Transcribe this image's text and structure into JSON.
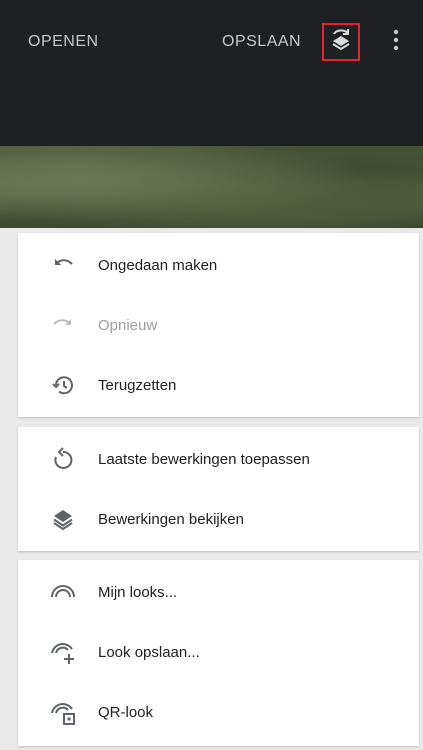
{
  "app_bar": {
    "open_label": "OPENEN",
    "save_label": "OPSLAAN",
    "stack_icon": "layers-undo-icon",
    "more_icon": "more-vert-icon"
  },
  "menu": {
    "groups": [
      {
        "items": [
          {
            "label": "Ongedaan maken",
            "icon": "undo-icon",
            "enabled": true
          },
          {
            "label": "Opnieuw",
            "icon": "redo-icon",
            "enabled": false
          },
          {
            "label": "Terugzetten",
            "icon": "history-icon",
            "enabled": true
          }
        ]
      },
      {
        "items": [
          {
            "label": "Laatste bewerkingen toepassen",
            "icon": "replay-icon",
            "enabled": true
          },
          {
            "label": "Bewerkingen bekijken",
            "icon": "layers-icon",
            "enabled": true
          }
        ]
      },
      {
        "items": [
          {
            "label": "Mijn looks...",
            "icon": "looks-icon",
            "enabled": true
          },
          {
            "label": "Look opslaan...",
            "icon": "looks-add-icon",
            "enabled": true
          },
          {
            "label": "QR-look",
            "icon": "looks-qr-icon",
            "enabled": true
          }
        ]
      }
    ]
  },
  "colors": {
    "topbar": "#1f2023",
    "highlight": "#e0262c",
    "text": "#212121",
    "disabled_text": "#9e9e9e",
    "icon": "#5f6368"
  }
}
